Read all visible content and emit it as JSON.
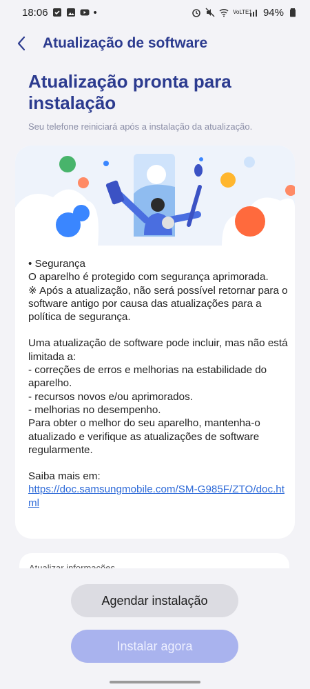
{
  "status_bar": {
    "time": "18:06",
    "dot": "•",
    "network_label": "VoLTE1",
    "battery": "94%"
  },
  "header": {
    "back_icon": "chevron-left-icon",
    "title": "Atualização de software"
  },
  "hero": {
    "title": "Atualização pronta para instalação",
    "subtitle": "Seu telefone reiniciará após a instalação da atualização."
  },
  "details": {
    "security_heading": "• Segurança",
    "security_line1": "O aparelho é protegido com segurança aprimorada.",
    "security_line2": "※ Após a atualização, não será possível retornar para o software antigo por causa das atualizações para a política de segurança.",
    "intro": "Uma atualização de software pode incluir, mas não está limitada a:",
    "item1": " - correções de erros e melhorias na estabilidade do aparelho.",
    "item2": " - recursos novos e/ou aprimorados.",
    "item3": " - melhorias no desempenho.",
    "closing": "Para obter o melhor do seu aparelho, mantenha-o atualizado e verifique as atualizações de software regularmente.",
    "learn_more": "Saiba mais em:",
    "link": "https://doc.samsungmobile.com/SM-G985F/ZTO/doc.html"
  },
  "next_section": {
    "label": "Atualizar informações"
  },
  "buttons": {
    "schedule": "Agendar instalação",
    "install": "Instalar agora"
  },
  "colors": {
    "title": "#2c3b8f",
    "primary_button": "#a9b3ee",
    "secondary_button": "#dcdce2",
    "link": "#2f6bd8"
  }
}
